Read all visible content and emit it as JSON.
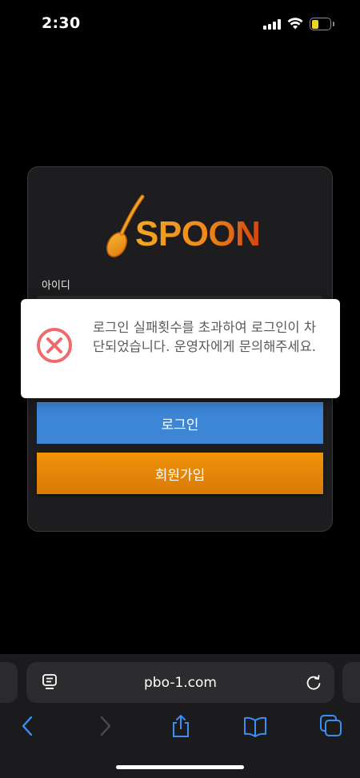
{
  "status_bar": {
    "time": "2:30",
    "battery_level": 0.4,
    "battery_color": "#f2d31b"
  },
  "login": {
    "logo_text": "SPOON",
    "id_label": "아이디",
    "login_button": "로그인",
    "signup_button": "회원가입",
    "colors": {
      "login": "#3d86d6",
      "signup": "#e8870a",
      "logo_start": "#f5a623",
      "logo_end": "#d2460f"
    }
  },
  "alert": {
    "icon": "error-circle-x-icon",
    "message": "로그인 실패횟수를 초과하여 로그인이 차단되었습니다. 운영자에게 문의해주세요."
  },
  "browser": {
    "url": "pbo-1.com",
    "icons": [
      "reader-icon",
      "reload-icon",
      "back-icon",
      "forward-icon",
      "share-icon",
      "bookmarks-icon",
      "tabs-icon"
    ]
  }
}
